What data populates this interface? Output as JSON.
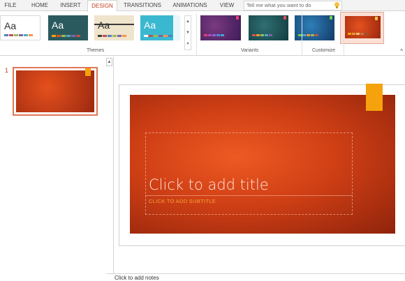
{
  "tabs": [
    {
      "label": "FILE"
    },
    {
      "label": "HOME"
    },
    {
      "label": "INSERT"
    },
    {
      "label": "DESIGN",
      "active": true
    },
    {
      "label": "TRANSITIONS"
    },
    {
      "label": "ANIMATIONS"
    },
    {
      "label": "VIEW"
    }
  ],
  "tell_me": {
    "placeholder": "Tell me what you want to do"
  },
  "ribbon": {
    "groups": {
      "themes": "Themes",
      "variants": "Variants",
      "customize": "Customize"
    },
    "theme_sample_text": "Aa",
    "swatch_colors": [
      "#4f81bd",
      "#c0504d",
      "#9bbb59",
      "#8064a2",
      "#4bacc6",
      "#f79646"
    ]
  },
  "colors": {
    "accent": "#c43e1c",
    "slide_orange": "#cf3f15",
    "tab_highlight": "#f5a20c"
  },
  "slides_panel": {
    "slide_number": "1"
  },
  "slide": {
    "title_placeholder": "Click to add title",
    "subtitle_placeholder": "CLICK TO ADD SUBTITLE"
  },
  "notes": {
    "placeholder": "Click to add notes"
  }
}
